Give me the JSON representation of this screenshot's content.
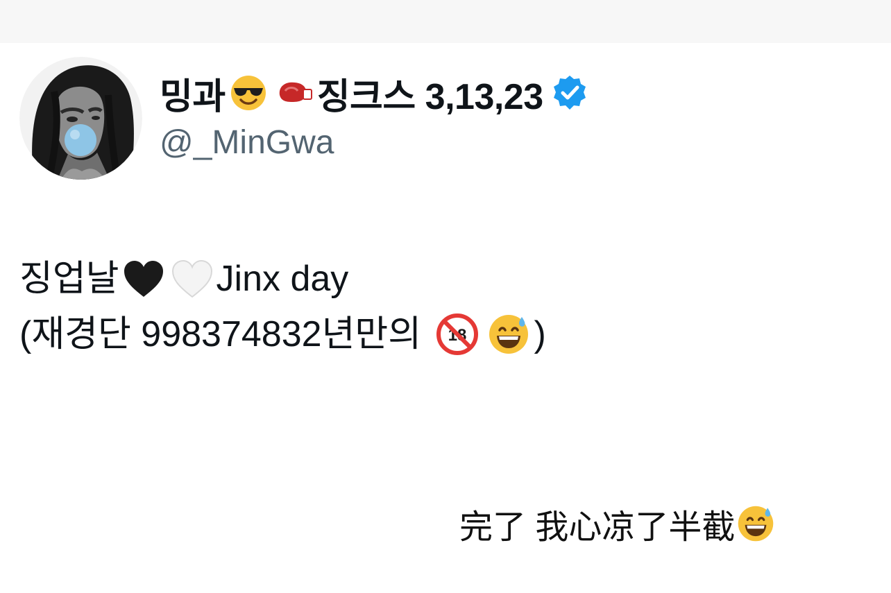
{
  "profile": {
    "avatar": "avatar-illustration",
    "display_name_part1": "밍과",
    "display_name_emoji1": "smiling-face-with-sunglasses",
    "display_name_emoji2": "boxing-glove",
    "display_name_part2": "징크스 3,13,23",
    "verified_badge": "verified-icon",
    "verified_color": "#1d9bf0",
    "handle": "@_MinGwa"
  },
  "tweet": {
    "line1_text_a": "징업날",
    "line1_emoji_a": "black-heart",
    "line1_emoji_b": "white-heart",
    "line1_text_b": "Jinx day",
    "line2_text_a": "(재경단 998374832년만의 ",
    "line2_emoji_a": "no-one-under-eighteen",
    "line2_emoji_b": "grinning-face-with-sweat",
    "line2_text_b": ")"
  },
  "caption": {
    "text": "完了 我心凉了半截",
    "emoji": "grinning-face-with-sweat"
  },
  "colors": {
    "text_primary": "#0f1419",
    "text_secondary": "#536471",
    "top_strip": "#f7f7f7"
  }
}
